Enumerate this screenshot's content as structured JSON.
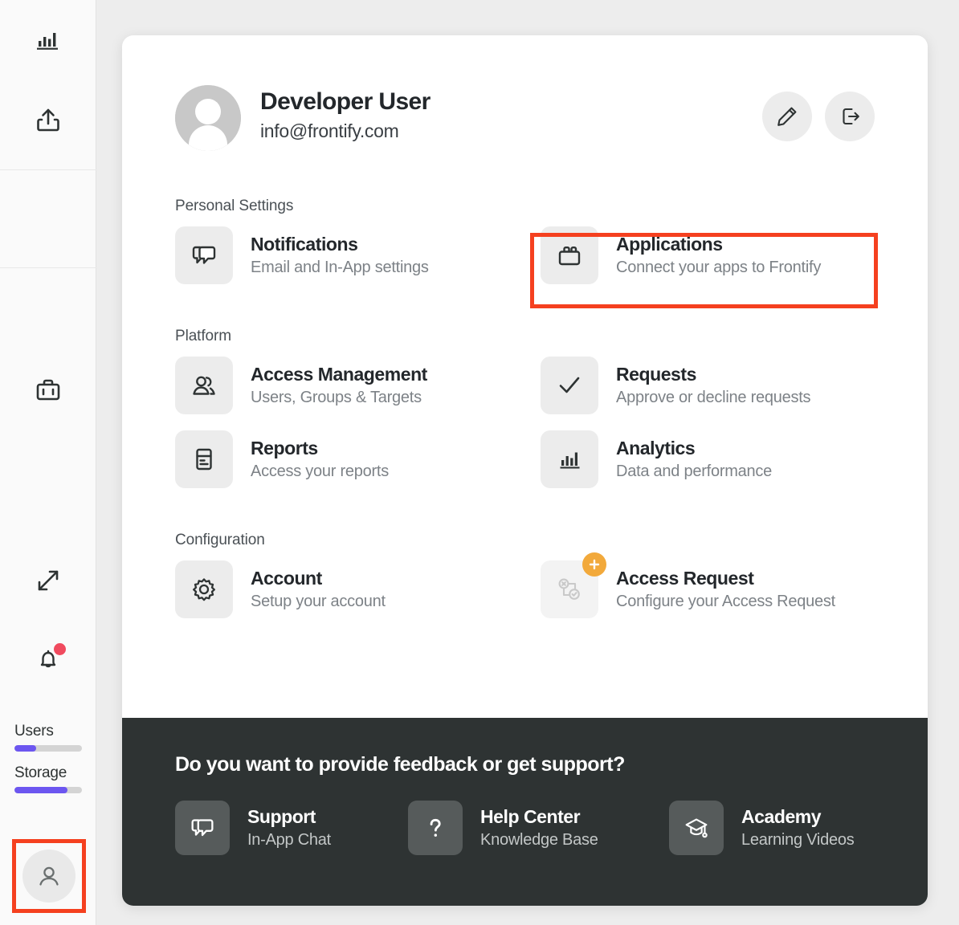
{
  "sidebar": {
    "nav_icons": [
      {
        "name": "analytics-icon",
        "label": "Analytics"
      },
      {
        "name": "upload-icon",
        "label": "Upload"
      },
      {
        "name": "briefcase-icon",
        "label": "Projects"
      }
    ],
    "expand_icon": "expand-icon",
    "notifications_icon": "bell-icon",
    "notification_dot_color": "#f04a5e",
    "meters": [
      {
        "label": "Users",
        "percent": 32
      },
      {
        "label": "Storage",
        "percent": 78
      }
    ],
    "meter_fill_color": "#6c56f0",
    "avatar_icon": "user-avatar-icon"
  },
  "highlights": {
    "color": "#f5401f",
    "targets": [
      "sidebar-avatar",
      "applications-tile"
    ]
  },
  "profile": {
    "name": "Developer User",
    "email": "info@frontify.com",
    "avatar_icon": "user-avatar-icon",
    "actions": [
      {
        "name": "edit-profile-button",
        "icon": "pencil-icon"
      },
      {
        "name": "logout-button",
        "icon": "logout-icon"
      }
    ]
  },
  "sections": [
    {
      "title": "Personal Settings",
      "tiles": [
        {
          "name": "notifications",
          "icon": "chat-bubbles-icon",
          "title": "Notifications",
          "subtitle": "Email and In-App settings",
          "muted": false,
          "badge": null
        },
        {
          "name": "applications",
          "icon": "toolbox-icon",
          "title": "Applications",
          "subtitle": "Connect your apps to Frontify",
          "muted": false,
          "badge": null
        }
      ]
    },
    {
      "title": "Platform",
      "tiles": [
        {
          "name": "access-management",
          "icon": "users-group-icon",
          "title": "Access Management",
          "subtitle": "Users, Groups & Targets",
          "muted": false,
          "badge": null
        },
        {
          "name": "requests",
          "icon": "check-icon",
          "title": "Requests",
          "subtitle": "Approve or decline requests",
          "muted": false,
          "badge": null
        },
        {
          "name": "reports",
          "icon": "report-document-icon",
          "title": "Reports",
          "subtitle": "Access your reports",
          "muted": false,
          "badge": null
        },
        {
          "name": "analytics",
          "icon": "bar-chart-icon",
          "title": "Analytics",
          "subtitle": "Data and performance",
          "muted": false,
          "badge": null
        }
      ]
    },
    {
      "title": "Configuration",
      "tiles": [
        {
          "name": "account",
          "icon": "gear-icon",
          "title": "Account",
          "subtitle": "Setup your account",
          "muted": false,
          "badge": null
        },
        {
          "name": "access-request",
          "icon": "access-request-icon",
          "title": "Access Request",
          "subtitle": "Configure your Access Request",
          "muted": true,
          "badge": "plus-badge"
        }
      ]
    }
  ],
  "footer": {
    "title": "Do you want to provide feedback or get support?",
    "badge_color": "#f2a93b",
    "tiles": [
      {
        "name": "support",
        "icon": "chat-bubbles-icon",
        "title": "Support",
        "subtitle": "In-App Chat"
      },
      {
        "name": "help-center",
        "icon": "question-mark-icon",
        "title": "Help Center",
        "subtitle": "Knowledge Base"
      },
      {
        "name": "academy",
        "icon": "graduation-cap-icon",
        "title": "Academy",
        "subtitle": "Learning Videos"
      }
    ]
  }
}
